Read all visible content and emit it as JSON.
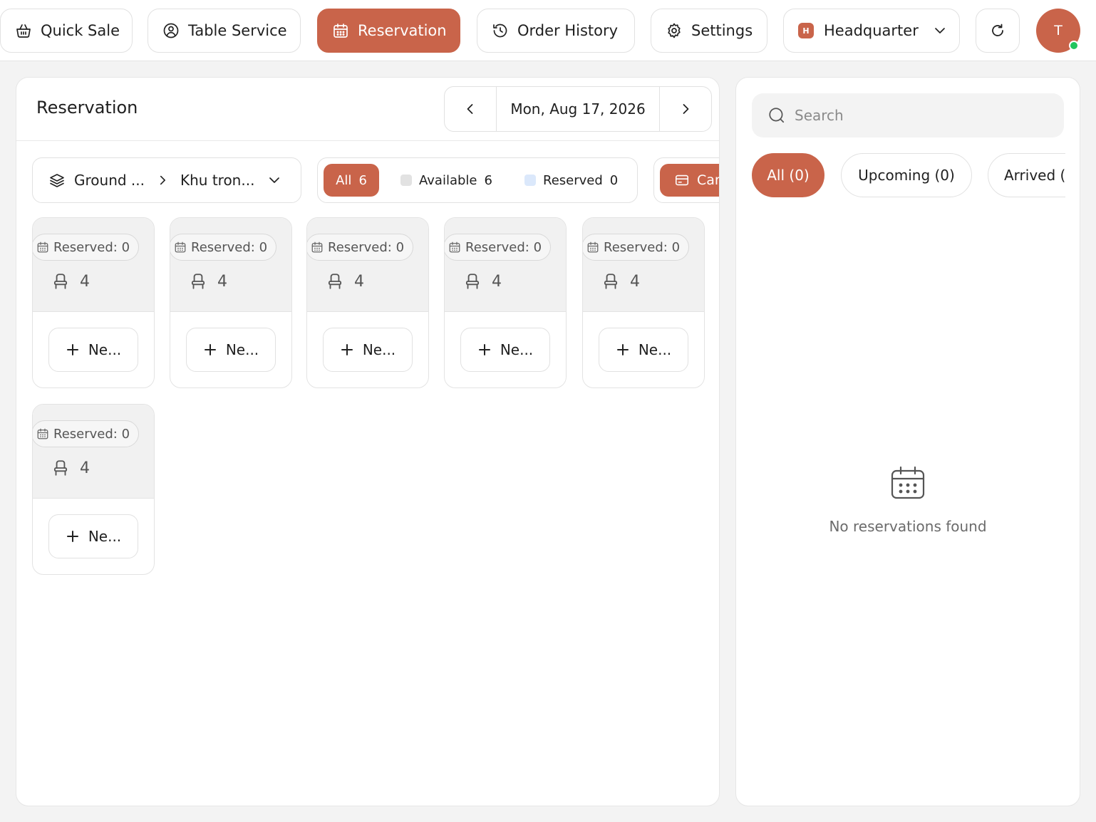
{
  "nav": {
    "quick_sale": "Quick Sale",
    "table_service": "Table Service",
    "reservation": "Reservation",
    "order_history": "Order History",
    "settings": "Settings",
    "branch_badge": "H",
    "branch": "Headquarter",
    "avatar_initial": "T"
  },
  "main": {
    "title": "Reservation",
    "date": "Mon, Aug 17, 2026",
    "floor": "Ground ...",
    "zone": "Khu tron...",
    "filters": {
      "all_label": "All",
      "all_count": "6",
      "available_label": "Available",
      "available_count": "6",
      "reserved_label": "Reserved",
      "reserved_count": "0"
    },
    "view_toggle": "Card",
    "tables": [
      {
        "reserved": "Reserved: 0",
        "seats": "4",
        "new_label": "Ne..."
      },
      {
        "reserved": "Reserved: 0",
        "seats": "4",
        "new_label": "Ne..."
      },
      {
        "reserved": "Reserved: 0",
        "seats": "4",
        "new_label": "Ne..."
      },
      {
        "reserved": "Reserved: 0",
        "seats": "4",
        "new_label": "Ne..."
      },
      {
        "reserved": "Reserved: 0",
        "seats": "4",
        "new_label": "Ne..."
      },
      {
        "reserved": "Reserved: 0",
        "seats": "4",
        "new_label": "Ne..."
      }
    ]
  },
  "side": {
    "search_placeholder": "Search",
    "tabs": {
      "all": "All (0)",
      "upcoming": "Upcoming (0)",
      "arrived": "Arrived ("
    },
    "empty_message": "No reservations found"
  },
  "colors": {
    "accent": "#c9644a",
    "available_swatch": "#e2e2e2",
    "reserved_swatch": "#dbe8fb",
    "online": "#22c55e"
  },
  "icons": {
    "quick_sale": "basket-icon",
    "table_service": "waiter-icon",
    "reservation": "calendar-icon",
    "order_history": "history-icon",
    "settings": "gear-icon",
    "branch_menu": "chevron-down-icon",
    "refresh": "refresh-icon",
    "floor": "layers-icon",
    "seat": "chair-icon",
    "search": "search-icon"
  }
}
